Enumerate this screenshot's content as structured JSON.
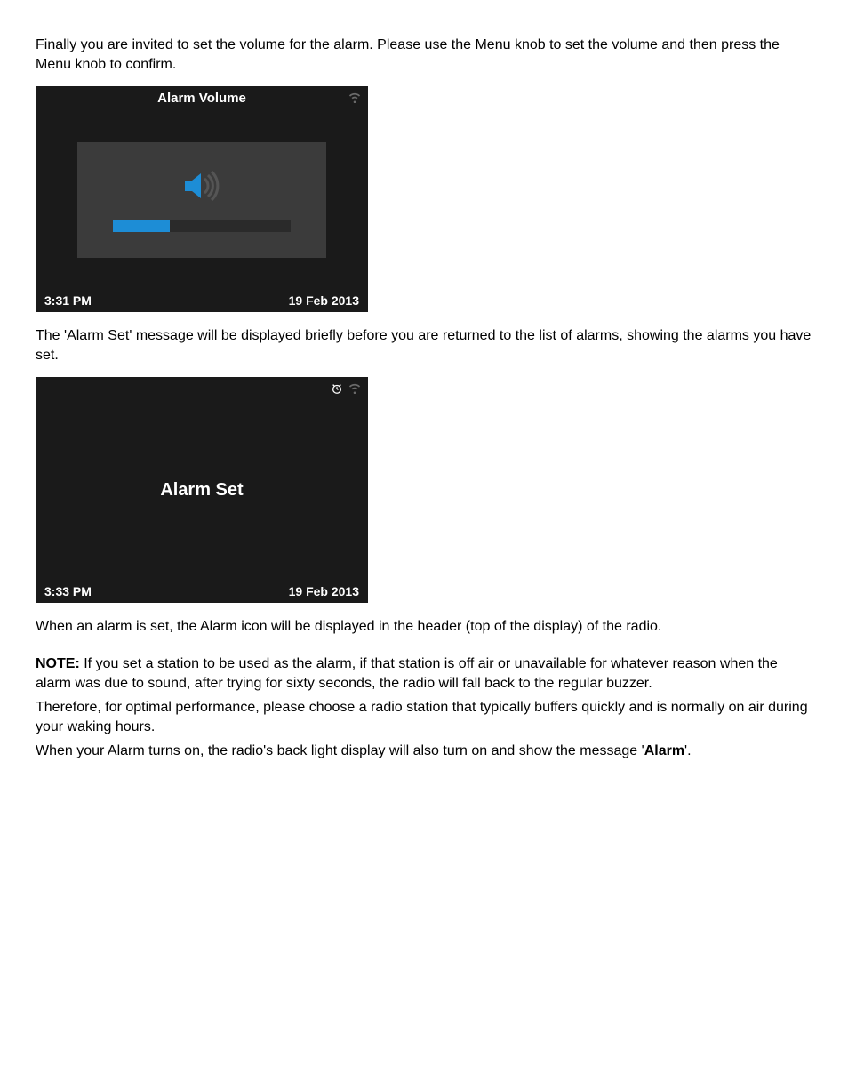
{
  "para1": "Finally you are invited to set the volume for the alarm. Please use the Menu knob to set the volume and then press the Menu knob to confirm.",
  "screenshot1": {
    "headerTitle": "Alarm Volume",
    "footerTime": "3:31 PM",
    "footerDate": "19 Feb 2013"
  },
  "para2": "The 'Alarm Set' message will be displayed briefly before you are returned to the list of alarms, showing the alarms you have set.",
  "screenshot2": {
    "bodyText": "Alarm Set",
    "footerTime": "3:33 PM",
    "footerDate": "19 Feb 2013"
  },
  "para3": "When an alarm is set, the Alarm icon will be displayed in the header (top of the display) of the radio.",
  "noteLabel": "NOTE:",
  "noteText1": "  If you set a station to be used as the alarm, if that station is off air or unavailable for whatever reason when the alarm was due to sound, after trying for sixty seconds, the radio will fall back to the regular buzzer.",
  "noteText2": "Therefore, for optimal performance, please choose a radio station that typically buffers quickly and is normally on air during your waking hours.",
  "noteText3a": "When your Alarm turns on, the radio's back light display will also turn on and show the message '",
  "noteText3b": "Alarm",
  "noteText3c": "'."
}
